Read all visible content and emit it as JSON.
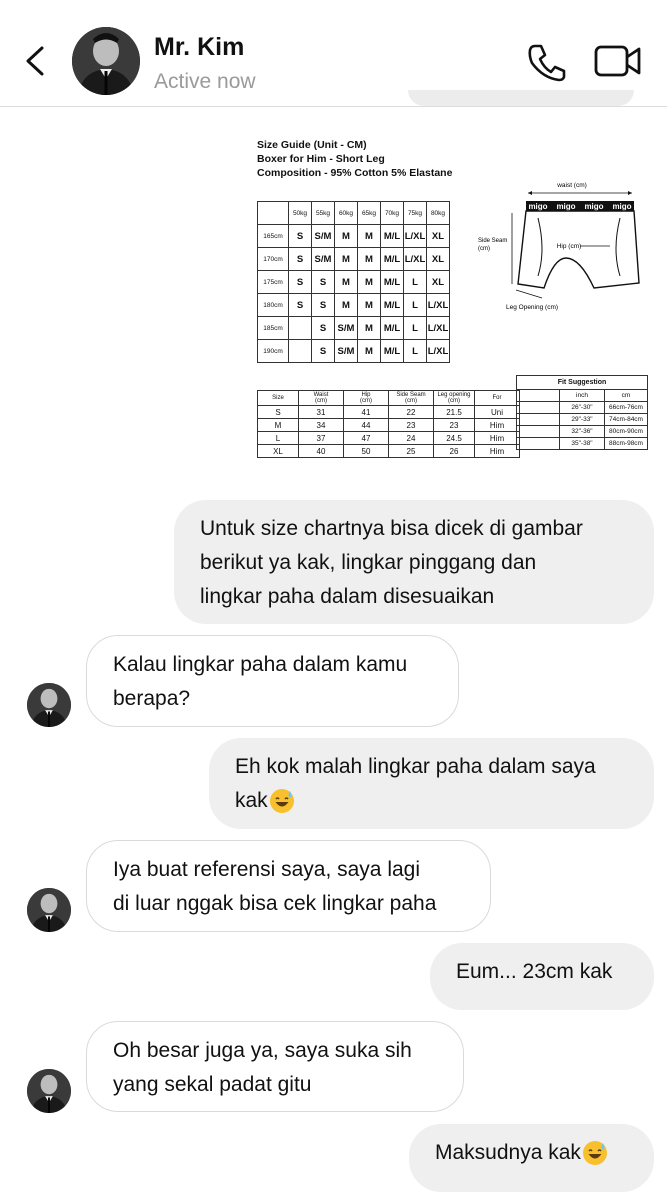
{
  "header": {
    "name": "Mr. Kim",
    "status": "Active now",
    "icons": [
      "chevron-left-icon",
      "phone-icon",
      "video-camera-icon"
    ]
  },
  "size_guide": {
    "title_lines": [
      "Size Guide (Unit - CM)",
      "Boxer for Him - Short Leg",
      "Composition - 95% Cotton 5% Elastane"
    ],
    "weight_headers": [
      "50kg",
      "55kg",
      "60kg",
      "65kg",
      "70kg",
      "75kg",
      "80kg"
    ],
    "height_rows": [
      {
        "h": "165cm",
        "cells": [
          "S",
          "S/M",
          "M",
          "M",
          "M/L",
          "L/XL",
          "XL"
        ]
      },
      {
        "h": "170cm",
        "cells": [
          "S",
          "S/M",
          "M",
          "M",
          "M/L",
          "L/XL",
          "XL"
        ]
      },
      {
        "h": "175cm",
        "cells": [
          "S",
          "S",
          "M",
          "M",
          "M/L",
          "L",
          "XL"
        ]
      },
      {
        "h": "180cm",
        "cells": [
          "S",
          "S",
          "M",
          "M",
          "M/L",
          "L",
          "L/XL"
        ]
      },
      {
        "h": "185cm",
        "cells": [
          "",
          "S",
          "S/M",
          "M",
          "M/L",
          "L",
          "L/XL"
        ]
      },
      {
        "h": "190cm",
        "cells": [
          "",
          "S",
          "S/M",
          "M",
          "M/L",
          "L",
          "L/XL"
        ]
      }
    ],
    "diagram": {
      "waist_label": "waist (cm)",
      "hip_label": "Hip (cm)",
      "side_seam_label": "Side Seam",
      "side_seam_unit": "(cm)",
      "leg_opening_label": "Leg Opening (cm)",
      "brand": "migo"
    },
    "measure_headers": [
      [
        "Size",
        ""
      ],
      [
        "Waist",
        "(cm)"
      ],
      [
        "Hip",
        "(cm)"
      ],
      [
        "Side Seam",
        "(cm)"
      ],
      [
        "Leg opening",
        "(cm)"
      ],
      [
        "For",
        ""
      ]
    ],
    "measure_rows": [
      [
        "S",
        "31",
        "41",
        "22",
        "21.5",
        "Uni"
      ],
      [
        "M",
        "34",
        "44",
        "23",
        "23",
        "Him"
      ],
      [
        "L",
        "37",
        "47",
        "24",
        "24.5",
        "Him"
      ],
      [
        "XL",
        "40",
        "50",
        "25",
        "26",
        "Him"
      ]
    ],
    "fit_title": "Fit Suggestion",
    "fit_headers": [
      "inch",
      "cm"
    ],
    "fit_rows": [
      [
        "26\"-30\"",
        "66cm-76cm"
      ],
      [
        "29\"-33\"",
        "74cm-84cm"
      ],
      [
        "32\"-36\"",
        "80cm-90cm"
      ],
      [
        "35\"-38\"",
        "88cm-98cm"
      ]
    ]
  },
  "messages": [
    {
      "dir": "out",
      "lines": [
        "Untuk size chartnya bisa dicek di gambar",
        "berikut ya kak, lingkar pinggang dan",
        "lingkar paha dalam disesuaikan"
      ]
    },
    {
      "dir": "in",
      "lines": [
        "Kalau lingkar paha dalam kamu",
        "berapa?"
      ]
    },
    {
      "dir": "out",
      "lines": [
        "Eh kok malah lingkar paha dalam saya",
        "kak"
      ],
      "emoji": "sweat-smile-emoji"
    },
    {
      "dir": "in",
      "lines": [
        "Iya buat referensi saya, saya lagi",
        "di luar nggak bisa cek lingkar paha"
      ]
    },
    {
      "dir": "out",
      "lines": [
        "Eum... 23cm kak"
      ]
    },
    {
      "dir": "in",
      "lines": [
        "Oh besar juga ya, saya suka sih",
        "yang sekal padat gitu"
      ]
    },
    {
      "dir": "out",
      "lines": [
        "Maksudnya kak"
      ],
      "emoji": "sweat-smile-emoji"
    }
  ]
}
